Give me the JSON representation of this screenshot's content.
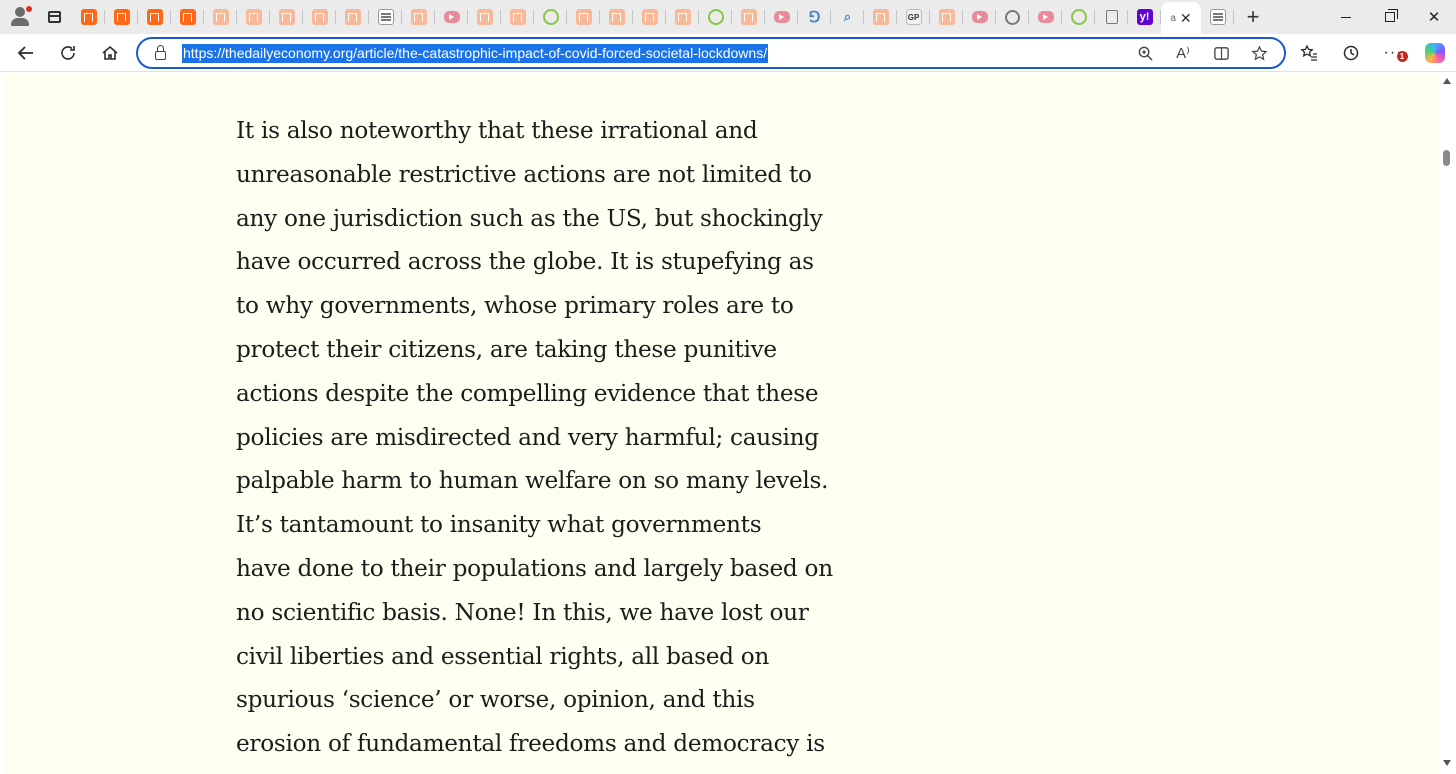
{
  "browser": {
    "tabs": [
      {
        "favicon": "substack-icon",
        "kind": "orange"
      },
      {
        "favicon": "substack-icon",
        "kind": "orange"
      },
      {
        "favicon": "substack-icon",
        "kind": "orange"
      },
      {
        "favicon": "substack-icon",
        "kind": "orange"
      },
      {
        "favicon": "substack-icon",
        "kind": "peach"
      },
      {
        "favicon": "substack-icon",
        "kind": "peach"
      },
      {
        "favicon": "substack-icon",
        "kind": "peach"
      },
      {
        "favicon": "substack-icon",
        "kind": "peach"
      },
      {
        "favicon": "substack-icon",
        "kind": "peach"
      },
      {
        "favicon": "news-icon",
        "kind": "news"
      },
      {
        "favicon": "substack-icon",
        "kind": "peach"
      },
      {
        "favicon": "youtube-icon",
        "kind": "yt"
      },
      {
        "favicon": "substack-icon",
        "kind": "peach"
      },
      {
        "favicon": "substack-icon",
        "kind": "peach"
      },
      {
        "favicon": "rumble-icon",
        "kind": "rumble"
      },
      {
        "favicon": "substack-icon",
        "kind": "peach"
      },
      {
        "favicon": "substack-icon",
        "kind": "peach"
      },
      {
        "favicon": "substack-icon",
        "kind": "peach"
      },
      {
        "favicon": "substack-icon",
        "kind": "peach"
      },
      {
        "favicon": "rumble-icon",
        "kind": "rumble"
      },
      {
        "favicon": "substack-icon",
        "kind": "peach"
      },
      {
        "favicon": "youtube-icon",
        "kind": "yt"
      },
      {
        "favicon": "translate-icon",
        "kind": "blue"
      },
      {
        "favicon": "search-icon",
        "kind": "blue"
      },
      {
        "favicon": "substack-icon",
        "kind": "peach"
      },
      {
        "favicon": "gp-icon",
        "kind": "gp"
      },
      {
        "favicon": "substack-icon",
        "kind": "peach"
      },
      {
        "favicon": "youtube-icon",
        "kind": "yt"
      },
      {
        "favicon": "settings-icon",
        "kind": "gear"
      },
      {
        "favicon": "youtube-icon",
        "kind": "yt"
      },
      {
        "favicon": "rumble-icon",
        "kind": "rumble"
      },
      {
        "favicon": "document-icon",
        "kind": "doc"
      },
      {
        "favicon": "yahoo-icon",
        "kind": "yahoo"
      }
    ],
    "active_tab": {
      "frag": "a",
      "close_glyph": "✕"
    },
    "after_tab": {
      "favicon": "news-icon",
      "kind": "news"
    },
    "new_tab_glyph": "+",
    "window_close_glyph": "✕",
    "gp_text": "GP",
    "yahoo_text": "y!",
    "url": "https://thedailyeconomy.org/article/the-catastrophic-impact-of-covid-forced-societal-lockdowns/",
    "read_aloud_glyph": "A⁾",
    "notification_count": "1",
    "accent_color": "#1a73e8"
  },
  "article": {
    "lines": [
      "It is also noteworthy that these irrational and",
      "unreasonable restrictive actions are not limited to",
      "any one jurisdiction such as the US, but shockingly",
      "have occurred across the globe. It is stupefying as",
      "to why governments, whose primary roles are to",
      "protect their citizens, are taking these punitive",
      "actions despite the compelling evidence that these",
      "policies are misdirected and very harmful; causing",
      "palpable harm to human welfare on so many levels.",
      "It’s tantamount to insanity what governments",
      "have done to their populations and largely based on",
      "no scientific basis. None! In this, we have lost our",
      "civil liberties and essential rights, all based on",
      "spurious ‘science’ or worse, opinion, and this",
      "erosion of fundamental freedoms and democracy is"
    ],
    "background": "#fffff1"
  }
}
